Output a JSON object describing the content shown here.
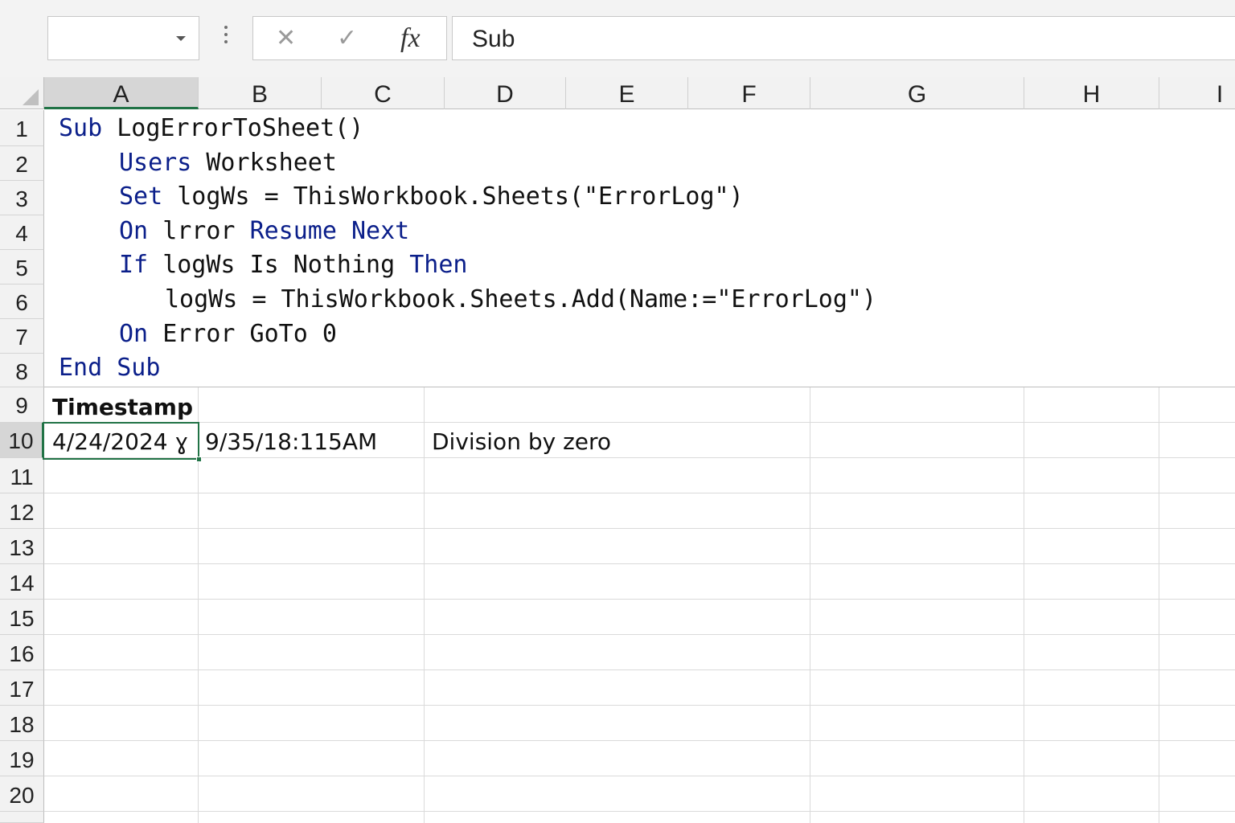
{
  "name_box": {
    "value": ""
  },
  "formula_bar": {
    "content": "Sub",
    "cancel_icon": "close-icon",
    "enter_icon": "check-icon",
    "fx_label": "fx"
  },
  "columns": [
    "A",
    "B",
    "C",
    "D",
    "E",
    "F",
    "G",
    "H",
    "I"
  ],
  "rows": [
    "1",
    "2",
    "3",
    "4",
    "5",
    "6",
    "7",
    "8",
    "9",
    "10",
    "11",
    "12",
    "13",
    "14",
    "15",
    "16",
    "17",
    "18",
    "19",
    "20"
  ],
  "active_cell": "A10",
  "code": {
    "l1_kw": "Sub",
    "l1_rest": "LogErrorToSheet()",
    "l2_kw": "Users",
    "l2_rest": "Worksheet",
    "l3_kw": "Set",
    "l3_rest": "logWs = ThisWorkbook.Sheets(\"ErrorLog\")",
    "l4_kw1": "On",
    "l4_mid": "lrror",
    "l4_kw2": "Resume Next",
    "l5_kw1": "If",
    "l5_mid": "logWs Is Nothing",
    "l5_kw2": "Then",
    "l6_rest": "logWs = ThisWorkbook.Sheets.Add(Name:=\"ErrorLog\")",
    "l7_kw": "On",
    "l7_rest": "Error GoTo 0",
    "l8_kw": "End Sub"
  },
  "cells": {
    "a9": "Timestamp",
    "a10": "4/24/2024 ɣ",
    "b10": "9/35/18:115AM",
    "d10": "Division by zero"
  }
}
